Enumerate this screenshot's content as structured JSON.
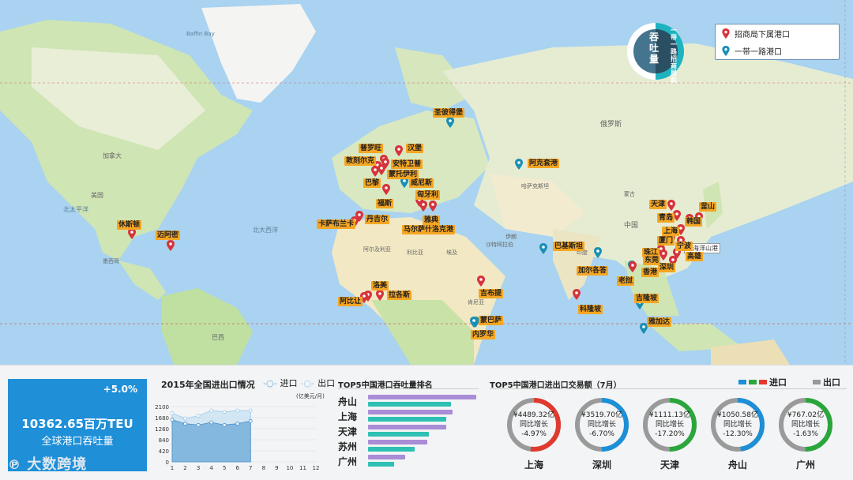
{
  "badge": {
    "main": "吞吐量",
    "side": "一带一路招商局和"
  },
  "legend": {
    "items": [
      {
        "label": "招商局下属港口",
        "color": "#d6333b"
      },
      {
        "label": "一带一路港口",
        "color": "#1a8fb5"
      }
    ]
  },
  "map": {
    "labels": {
      "greenland": "Baffin Bay",
      "northpacific": "北太平洋",
      "northatlantic": "北大西洋",
      "us": "美国",
      "canada": "加拿大",
      "russia": "俄罗斯",
      "kazak": "哈萨克斯坦",
      "china": "中国",
      "india": "印度",
      "mongolia": "蒙古",
      "brazil": "巴西",
      "algeria": "阿尔及利亚",
      "libya": "利比亚",
      "egypt": "埃及",
      "mexico": "墨西哥",
      "saudi": "沙特阿拉伯",
      "iran": "伊朗",
      "kenya": "肯尼亚",
      "shanghai_port": "上海洋山港"
    },
    "ports": [
      {
        "name": "圣彼得堡",
        "type": "belt"
      },
      {
        "name": "汉堡",
        "type": "cm"
      },
      {
        "name": "普罗旺",
        "type": "cm"
      },
      {
        "name": "敦刻尔克",
        "type": "cm"
      },
      {
        "name": "安特卫普",
        "type": "cm"
      },
      {
        "name": "蒙托伊利",
        "type": "cm"
      },
      {
        "name": "巴黎",
        "type": "cm"
      },
      {
        "name": "威尼斯",
        "type": "belt"
      },
      {
        "name": "匈牙利",
        "type": "cm"
      },
      {
        "name": "福斯",
        "type": "cm"
      },
      {
        "name": "雅典",
        "type": "cm"
      },
      {
        "name": "丹吉尔",
        "type": "cm"
      },
      {
        "name": "卡萨布兰卡",
        "type": "cm"
      },
      {
        "name": "马尔萨什洛克港",
        "type": "cm"
      },
      {
        "name": "阿克套港",
        "type": "belt"
      },
      {
        "name": "巴基斯坦",
        "type": "belt"
      },
      {
        "name": "加尔各答",
        "type": "belt"
      },
      {
        "name": "吉布提",
        "type": "cm"
      },
      {
        "name": "蒙巴萨",
        "type": "belt"
      },
      {
        "name": "洛美",
        "type": "cm"
      },
      {
        "name": "拉各斯",
        "type": "cm"
      },
      {
        "name": "阿比让",
        "type": "cm"
      },
      {
        "name": "内罗华",
        "type": "belt"
      },
      {
        "name": "科隆坡",
        "type": "cm"
      },
      {
        "name": "老挝",
        "type": "belt"
      },
      {
        "name": "吉隆坡",
        "type": "belt"
      },
      {
        "name": "雅加达",
        "type": "belt"
      },
      {
        "name": "天津",
        "type": "cm"
      },
      {
        "name": "青岛",
        "type": "cm"
      },
      {
        "name": "上海",
        "type": "cm"
      },
      {
        "name": "釜山",
        "type": "cm"
      },
      {
        "name": "韩国",
        "type": "cm"
      },
      {
        "name": "厦门",
        "type": "cm"
      },
      {
        "name": "宁波",
        "type": "cm"
      },
      {
        "name": "高雄",
        "type": "cm"
      },
      {
        "name": "珠江",
        "type": "cm"
      },
      {
        "name": "东莞",
        "type": "cm"
      },
      {
        "name": "深圳",
        "type": "cm"
      },
      {
        "name": "香港",
        "type": "cm"
      },
      {
        "name": "休斯顿",
        "type": "cm"
      },
      {
        "name": "迈阿密",
        "type": "cm"
      }
    ]
  },
  "kpi": {
    "pct": "+5.0%",
    "value": "10362.65百万TEU",
    "caption": "全球港口吞吐量"
  },
  "logo": "大数跨境",
  "trade": {
    "title": "2015年全国进出口情况",
    "unit": "(亿美元/月)",
    "legend_in": "进口",
    "legend_out": "出口",
    "y_ticks": [
      "2100",
      "1680",
      "1260",
      "840",
      "420",
      "0"
    ],
    "x_ticks": [
      "1",
      "2",
      "3",
      "4",
      "5",
      "6",
      "7",
      "8",
      "9",
      "10",
      "11",
      "12"
    ]
  },
  "ranking": {
    "title": "TOP5中国港口吞吐量排名",
    "items": [
      {
        "name": "舟山",
        "a": 1.0,
        "b": 0.77
      },
      {
        "name": "上海",
        "a": 0.78,
        "b": 0.72
      },
      {
        "name": "天津",
        "a": 0.72,
        "b": 0.56
      },
      {
        "name": "苏州",
        "a": 0.55,
        "b": 0.43
      },
      {
        "name": "广州",
        "a": 0.34,
        "b": 0.24
      }
    ]
  },
  "donuts": {
    "title": "TOP5中国港口进出口交易额（7月）",
    "legend_in": "进口",
    "legend_out": "出口",
    "growth_label": "同比增长",
    "items": [
      {
        "amount": "¥4489.32亿",
        "growth": "-4.97%",
        "city": "上海",
        "color": "#e03a2f",
        "frac": 0.52
      },
      {
        "amount": "¥3519.70亿",
        "growth": "-6.70%",
        "city": "深圳",
        "color": "#1d8fd6",
        "frac": 0.5
      },
      {
        "amount": "¥1111.13亿",
        "growth": "-17.20%",
        "city": "天津",
        "color": "#2aa63c",
        "frac": 0.5
      },
      {
        "amount": "¥1050.58亿",
        "growth": "-12.30%",
        "city": "舟山",
        "color": "#1d8fd6",
        "frac": 0.48
      },
      {
        "amount": "¥767.02亿",
        "growth": "-1.63%",
        "city": "广州",
        "color": "#2aa63c",
        "frac": 0.5
      }
    ]
  },
  "chart_data": {
    "type": "area",
    "title": "2015年全国进出口情况",
    "x": [
      1,
      2,
      3,
      4,
      5,
      6,
      7
    ],
    "series": [
      {
        "name": "进口",
        "values": [
          1600,
          1450,
          1400,
          1500,
          1400,
          1450,
          1550
        ]
      },
      {
        "name": "出口",
        "values": [
          1850,
          1650,
          1750,
          1950,
          1900,
          1950,
          1950
        ]
      }
    ],
    "ylim": [
      0,
      2100
    ],
    "xlim": [
      1,
      12
    ]
  }
}
